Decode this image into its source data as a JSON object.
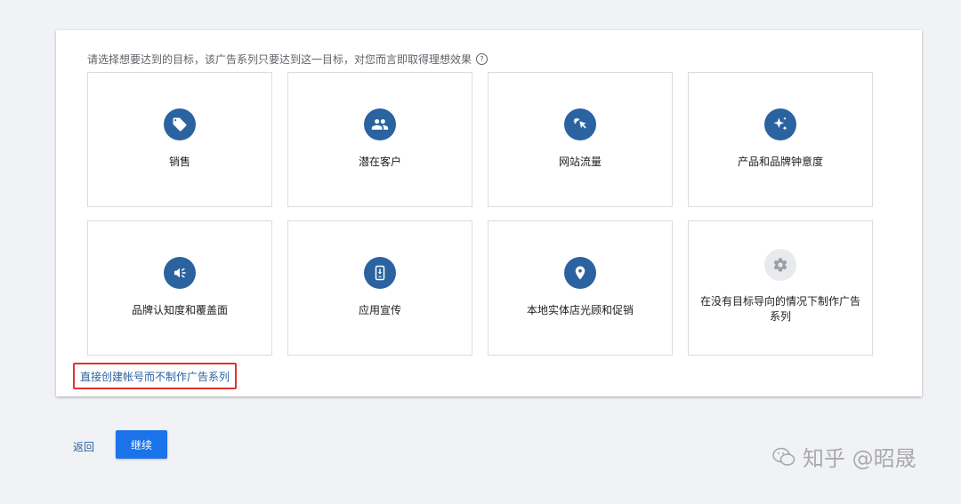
{
  "prompt": {
    "text": "请选择想要达到的目标，该广告系列只要达到这一目标，对您而言即取得理想效果",
    "help_icon": "?"
  },
  "goals": [
    {
      "label": "销售",
      "icon": "tag-icon"
    },
    {
      "label": "潜在客户",
      "icon": "people-icon"
    },
    {
      "label": "网站流量",
      "icon": "cursor-click-icon"
    },
    {
      "label": "产品和品牌钟意度",
      "icon": "sparkle-icon"
    },
    {
      "label": "品牌认知度和覆盖面",
      "icon": "megaphone-icon"
    },
    {
      "label": "应用宣传",
      "icon": "phone-download-icon"
    },
    {
      "label": "本地实体店光顾和促销",
      "icon": "location-pin-icon"
    },
    {
      "label": "在没有目标导向的情况下制作广告系列",
      "icon": "gear-icon"
    }
  ],
  "direct_link": "直接创建帐号而不制作广告系列",
  "back_label": "返回",
  "continue_label": "继续",
  "watermark": "知乎 @昭晟",
  "colors": {
    "accent": "#2b62a0",
    "button": "#1a73e8",
    "highlight_border": "#e0332d"
  }
}
